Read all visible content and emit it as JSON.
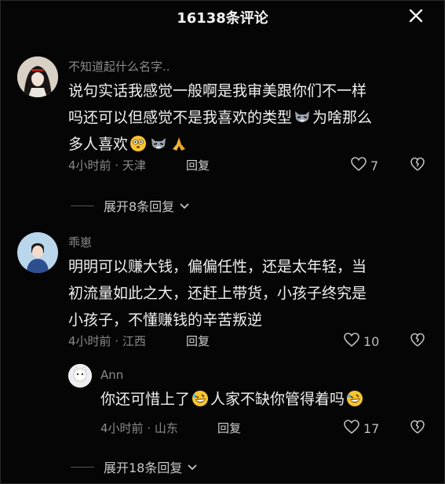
{
  "header": {
    "title": "16138条评论",
    "close_icon": "close-icon"
  },
  "comments": [
    {
      "user": "不知道起什么名字..",
      "lines": [
        "说句实话我感觉一般啊是我审美跟你们不一样",
        "吗还可以但感觉不是我喜欢的类型",
        "为啥那么",
        "多人喜欢"
      ],
      "meta": "4小时前 · 天津",
      "reply_label": "回复",
      "likes": "7",
      "expand_label": "展开8条回复",
      "emojis": [
        "wolf-face-emoji",
        "flushed-face-emoji",
        "wolf-face-emoji",
        "praying-hands-emoji"
      ]
    },
    {
      "user": "乖崽",
      "lines": [
        "明明可以赚大钱，偏偏任性，还是太年轻，当",
        "初流量如此之大，还赶上带货，小孩子终究是",
        "小孩子，不懂赚钱的辛苦叛逆"
      ],
      "meta": "4小时前 · 江西",
      "reply_label": "回复",
      "likes": "10"
    }
  ],
  "sub_reply": {
    "user": "Ann",
    "text_a": "你还可惜上了",
    "text_b": "人家不缺你管得着吗",
    "meta": "4小时前 · 山东",
    "reply_label": "回复",
    "likes": "17",
    "emojis": [
      "rofl-face-emoji",
      "rofl-face-emoji"
    ]
  },
  "expand2_label": "展开18条回复",
  "colors": {
    "background": "#050505",
    "text": "#f0f0f0",
    "muted": "#8a8a8a",
    "emoji_yellow": "#f7c531"
  }
}
